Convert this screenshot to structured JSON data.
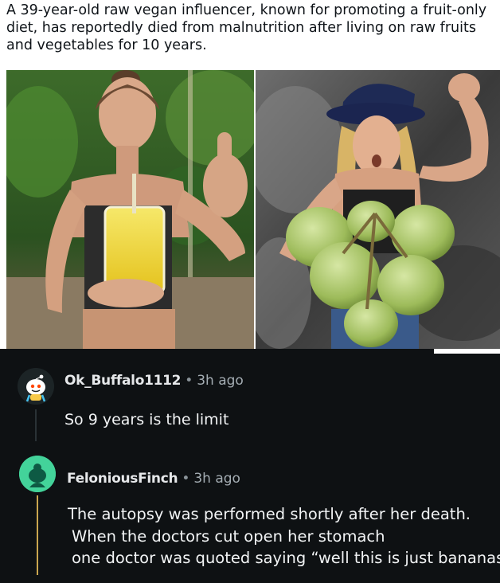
{
  "post": {
    "text": "A 39-year-old raw vegan influencer, known for promoting a fruit-only diet, has reportedly died from malnutrition after living on raw fruits and vegetables for 10 years."
  },
  "comments": [
    {
      "username": "Ok_Buffalo1112",
      "separator": "•",
      "time": "3h ago",
      "body": [
        "So 9 years is the limit"
      ]
    },
    {
      "username": "FeloniousFinch",
      "separator": "•",
      "time": "3h ago",
      "body": [
        "The autopsy was performed shortly after her death.",
        "When the doctors cut open her stomach",
        "one doctor was quoted saying “well this is just bananas”."
      ]
    }
  ],
  "colors": {
    "comments_bg": "#0e1113",
    "thread_line_2": "#caa64f",
    "avatar_2": "#43d39a"
  }
}
